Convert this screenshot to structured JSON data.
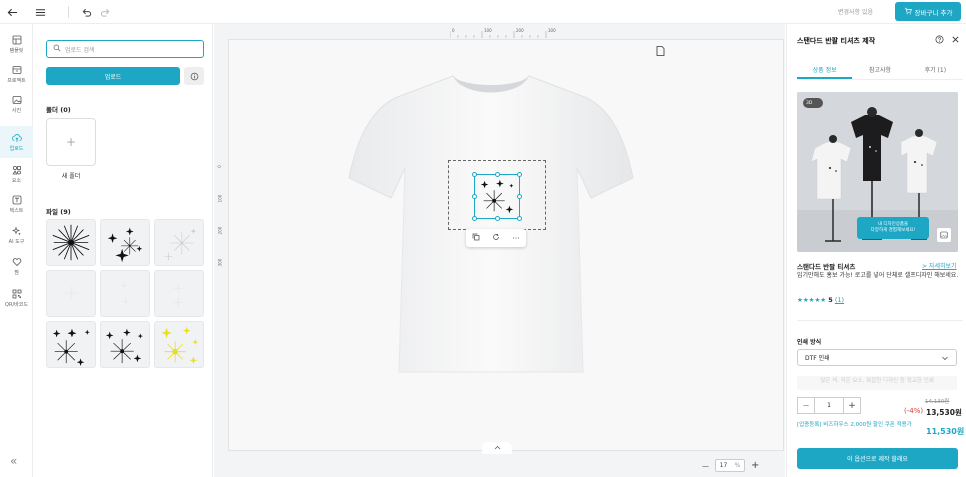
{
  "topbar": {
    "status": "변경사항 있음",
    "cart_button": "장바구니 추가"
  },
  "rail": {
    "items": [
      {
        "label": "템플릿",
        "icon": "template-icon"
      },
      {
        "label": "프로젝트",
        "icon": "project-icon"
      },
      {
        "label": "사진",
        "icon": "photo-icon"
      },
      {
        "label": "업로드",
        "icon": "upload-icon"
      },
      {
        "label": "요소",
        "icon": "elements-icon"
      },
      {
        "label": "텍스트",
        "icon": "text-icon"
      },
      {
        "label": "AI 도구",
        "icon": "ai-tools-icon"
      },
      {
        "label": "찜",
        "icon": "heart-icon"
      },
      {
        "label": "QR/바코드",
        "icon": "qr-icon"
      }
    ],
    "collapse": "«"
  },
  "panel": {
    "search_placeholder": "업로드 검색",
    "upload_button": "업로드",
    "folders_title": "폴더 (0)",
    "new_folder_plus": "+",
    "new_folder_label": "새 폴더",
    "files_title": "파일 (9)"
  },
  "canvas": {
    "ruler_top": [
      "0",
      "100",
      "200",
      "300"
    ],
    "ruler_left": [
      "0",
      "100",
      "200",
      "300"
    ],
    "zoom_minus": "—",
    "zoom_value": "17",
    "zoom_unit": "%",
    "zoom_plus": "+",
    "toolbar_more": "···"
  },
  "right_panel": {
    "title": "스탠다드 반팔 티셔츠 제작",
    "tabs": [
      "상품 정보",
      "참고사항",
      "후기 (1)"
    ],
    "badge_3d": "3D",
    "image_cta_line1": "내 디자인상품을",
    "image_cta_line2": "다양하게 경험해보세요!",
    "product_name": "스탠다드 반팔 티셔츠",
    "details_link": "> 자세히보기",
    "description": "입기만해도 홍보 가능! 로고를 넣어 단체로 셀프디자인 해보세요.",
    "stars": "★★★★★",
    "rating_value": "5",
    "rating_count": "(1)",
    "print_label": "인쇄 방식",
    "print_value": "DTF 인쇄",
    "faded_note": "많은 색, 작은 요소, 복잡한 디자인 등 정교한 인쇄",
    "qty_minus": "—",
    "qty_value": "1",
    "qty_plus": "+",
    "old_price": "14,130원",
    "discount": "(-4%)",
    "price": "13,530원",
    "coupon_text": "[업종등록] 비즈하우스 2,000원 할인 쿠폰 적용가",
    "coupon_price": "11,530원",
    "make_button": "이 옵션으로 제작 할래요"
  },
  "colors": {
    "accent": "#1ea7c5",
    "discount": "#e03b3b",
    "sparkle_yellow": "#e8de2a"
  }
}
